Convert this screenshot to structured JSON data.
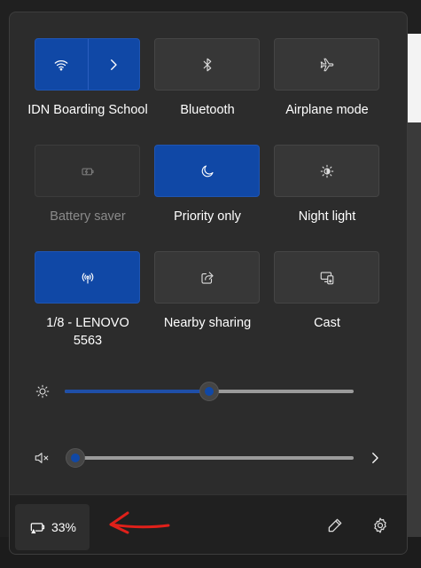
{
  "tiles": [
    {
      "label": "IDN Boarding School",
      "icon": "wifi-icon",
      "state": "on"
    },
    {
      "label": "Bluetooth",
      "icon": "bluetooth-icon",
      "state": "off"
    },
    {
      "label": "Airplane mode",
      "icon": "airplane-icon",
      "state": "off"
    },
    {
      "label": "Battery saver",
      "icon": "battery-saver-icon",
      "state": "disabled"
    },
    {
      "label": "Priority only",
      "icon": "moon-icon",
      "state": "on"
    },
    {
      "label": "Night light",
      "icon": "night-light-icon",
      "state": "off"
    },
    {
      "label": "1/8 - LENOVO 5563",
      "icon": "hotspot-icon",
      "state": "on"
    },
    {
      "label": "Nearby sharing",
      "icon": "share-icon",
      "state": "off"
    },
    {
      "label": "Cast",
      "icon": "cast-icon",
      "state": "off"
    }
  ],
  "brightness": {
    "icon": "brightness-icon",
    "value_percent": 50
  },
  "volume": {
    "icon": "volume-muted-icon",
    "value_percent": 0
  },
  "footer": {
    "battery_percent": "33%",
    "battery_icon": "battery-icon",
    "edit_icon": "pencil-icon",
    "settings_icon": "gear-icon"
  },
  "colors": {
    "accent": "#1048a6",
    "annotation": "#e0201a"
  }
}
